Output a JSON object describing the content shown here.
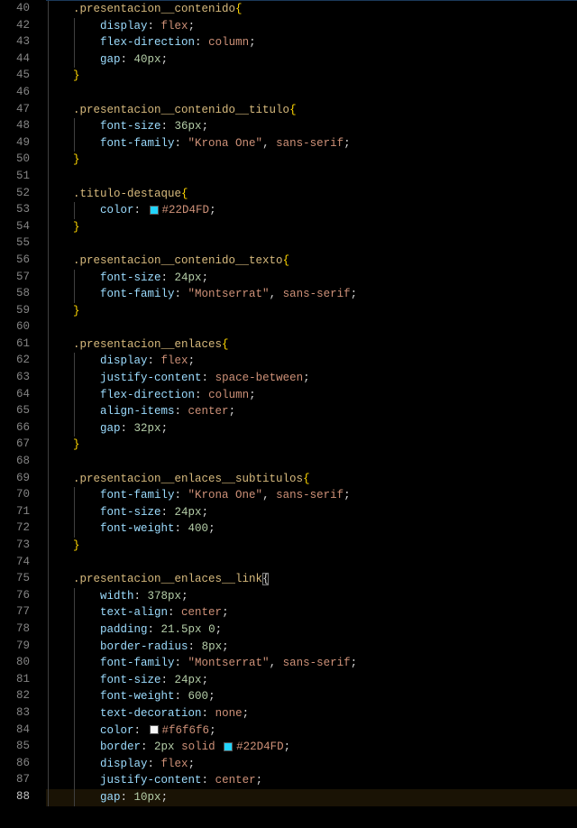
{
  "editor": {
    "language": "css",
    "active_line": 88
  },
  "lines": [
    {
      "n": 40,
      "ind": 1,
      "t": [
        {
          "c": "sel",
          "s": ".presentacion__contenido"
        },
        {
          "c": "brace",
          "s": "{"
        }
      ]
    },
    {
      "n": 42,
      "ind": 2,
      "t": [
        {
          "c": "prop",
          "s": "display"
        },
        {
          "c": "punc",
          "s": ": "
        },
        {
          "c": "val",
          "s": "flex"
        },
        {
          "c": "punc",
          "s": ";"
        }
      ]
    },
    {
      "n": 43,
      "ind": 2,
      "t": [
        {
          "c": "prop",
          "s": "flex-direction"
        },
        {
          "c": "punc",
          "s": ": "
        },
        {
          "c": "val",
          "s": "column"
        },
        {
          "c": "punc",
          "s": ";"
        }
      ]
    },
    {
      "n": 44,
      "ind": 2,
      "t": [
        {
          "c": "prop",
          "s": "gap"
        },
        {
          "c": "punc",
          "s": ": "
        },
        {
          "c": "num",
          "s": "40px"
        },
        {
          "c": "punc",
          "s": ";"
        }
      ]
    },
    {
      "n": 45,
      "ind": 1,
      "t": [
        {
          "c": "brace",
          "s": "}"
        }
      ]
    },
    {
      "n": 46,
      "ind": 1,
      "t": []
    },
    {
      "n": 47,
      "ind": 1,
      "t": [
        {
          "c": "sel",
          "s": ".presentacion__contenido__titulo"
        },
        {
          "c": "brace",
          "s": "{"
        }
      ]
    },
    {
      "n": 48,
      "ind": 2,
      "t": [
        {
          "c": "prop",
          "s": "font-size"
        },
        {
          "c": "punc",
          "s": ": "
        },
        {
          "c": "num",
          "s": "36px"
        },
        {
          "c": "punc",
          "s": ";"
        }
      ]
    },
    {
      "n": 49,
      "ind": 2,
      "t": [
        {
          "c": "prop",
          "s": "font-family"
        },
        {
          "c": "punc",
          "s": ": "
        },
        {
          "c": "str",
          "s": "\"Krona One\""
        },
        {
          "c": "punc",
          "s": ", "
        },
        {
          "c": "val",
          "s": "sans-serif"
        },
        {
          "c": "punc",
          "s": ";"
        }
      ]
    },
    {
      "n": 50,
      "ind": 1,
      "t": [
        {
          "c": "brace",
          "s": "}"
        }
      ]
    },
    {
      "n": 51,
      "ind": 1,
      "t": []
    },
    {
      "n": 52,
      "ind": 1,
      "t": [
        {
          "c": "sel",
          "s": ".titulo-destaque"
        },
        {
          "c": "brace",
          "s": "{"
        }
      ]
    },
    {
      "n": 53,
      "ind": 2,
      "t": [
        {
          "c": "prop",
          "s": "color"
        },
        {
          "c": "punc",
          "s": ": "
        },
        {
          "c": "swatch",
          "sw": "#22D4FD"
        },
        {
          "c": "val",
          "s": "#22D4FD"
        },
        {
          "c": "punc",
          "s": ";"
        }
      ]
    },
    {
      "n": 54,
      "ind": 1,
      "t": [
        {
          "c": "brace",
          "s": "}"
        }
      ]
    },
    {
      "n": 55,
      "ind": 1,
      "t": []
    },
    {
      "n": 56,
      "ind": 1,
      "t": [
        {
          "c": "sel",
          "s": ".presentacion__contenido__texto"
        },
        {
          "c": "brace",
          "s": "{"
        }
      ]
    },
    {
      "n": 57,
      "ind": 2,
      "t": [
        {
          "c": "prop",
          "s": "font-size"
        },
        {
          "c": "punc",
          "s": ": "
        },
        {
          "c": "num",
          "s": "24px"
        },
        {
          "c": "punc",
          "s": ";"
        }
      ]
    },
    {
      "n": 58,
      "ind": 2,
      "t": [
        {
          "c": "prop",
          "s": "font-family"
        },
        {
          "c": "punc",
          "s": ": "
        },
        {
          "c": "str",
          "s": "\"Montserrat\""
        },
        {
          "c": "punc",
          "s": ", "
        },
        {
          "c": "val",
          "s": "sans-serif"
        },
        {
          "c": "punc",
          "s": ";"
        }
      ]
    },
    {
      "n": 59,
      "ind": 1,
      "t": [
        {
          "c": "brace",
          "s": "}"
        }
      ]
    },
    {
      "n": 60,
      "ind": 1,
      "t": []
    },
    {
      "n": 61,
      "ind": 1,
      "t": [
        {
          "c": "sel",
          "s": ".presentacion__enlaces"
        },
        {
          "c": "brace",
          "s": "{"
        }
      ]
    },
    {
      "n": 62,
      "ind": 2,
      "t": [
        {
          "c": "prop",
          "s": "display"
        },
        {
          "c": "punc",
          "s": ": "
        },
        {
          "c": "val",
          "s": "flex"
        },
        {
          "c": "punc",
          "s": ";"
        }
      ]
    },
    {
      "n": 63,
      "ind": 2,
      "t": [
        {
          "c": "prop",
          "s": "justify-content"
        },
        {
          "c": "punc",
          "s": ": "
        },
        {
          "c": "val",
          "s": "space-between"
        },
        {
          "c": "punc",
          "s": ";"
        }
      ]
    },
    {
      "n": 64,
      "ind": 2,
      "t": [
        {
          "c": "prop",
          "s": "flex-direction"
        },
        {
          "c": "punc",
          "s": ": "
        },
        {
          "c": "val",
          "s": "column"
        },
        {
          "c": "punc",
          "s": ";"
        }
      ]
    },
    {
      "n": 65,
      "ind": 2,
      "t": [
        {
          "c": "prop",
          "s": "align-items"
        },
        {
          "c": "punc",
          "s": ": "
        },
        {
          "c": "val",
          "s": "center"
        },
        {
          "c": "punc",
          "s": ";"
        }
      ]
    },
    {
      "n": 66,
      "ind": 2,
      "t": [
        {
          "c": "prop",
          "s": "gap"
        },
        {
          "c": "punc",
          "s": ": "
        },
        {
          "c": "num",
          "s": "32px"
        },
        {
          "c": "punc",
          "s": ";"
        }
      ]
    },
    {
      "n": 67,
      "ind": 1,
      "t": [
        {
          "c": "brace",
          "s": "}"
        }
      ]
    },
    {
      "n": 68,
      "ind": 1,
      "t": []
    },
    {
      "n": 69,
      "ind": 1,
      "t": [
        {
          "c": "sel",
          "s": ".presentacion__enlaces__subtitulos"
        },
        {
          "c": "brace",
          "s": "{"
        }
      ]
    },
    {
      "n": 70,
      "ind": 2,
      "t": [
        {
          "c": "prop",
          "s": "font-family"
        },
        {
          "c": "punc",
          "s": ": "
        },
        {
          "c": "str",
          "s": "\"Krona One\""
        },
        {
          "c": "punc",
          "s": ", "
        },
        {
          "c": "val",
          "s": "sans-serif"
        },
        {
          "c": "punc",
          "s": ";"
        }
      ]
    },
    {
      "n": 71,
      "ind": 2,
      "t": [
        {
          "c": "prop",
          "s": "font-size"
        },
        {
          "c": "punc",
          "s": ": "
        },
        {
          "c": "num",
          "s": "24px"
        },
        {
          "c": "punc",
          "s": ";"
        }
      ]
    },
    {
      "n": 72,
      "ind": 2,
      "t": [
        {
          "c": "prop",
          "s": "font-weight"
        },
        {
          "c": "punc",
          "s": ": "
        },
        {
          "c": "num",
          "s": "400"
        },
        {
          "c": "punc",
          "s": ";"
        }
      ]
    },
    {
      "n": 73,
      "ind": 1,
      "t": [
        {
          "c": "brace",
          "s": "}"
        }
      ]
    },
    {
      "n": 74,
      "ind": 1,
      "t": []
    },
    {
      "n": 75,
      "ind": 1,
      "t": [
        {
          "c": "sel",
          "s": ".presentacion__enlaces__link"
        },
        {
          "c": "brace-muted",
          "s": "{"
        },
        {
          "c": "cursor"
        }
      ]
    },
    {
      "n": 76,
      "ind": 2,
      "t": [
        {
          "c": "prop",
          "s": "width"
        },
        {
          "c": "punc",
          "s": ": "
        },
        {
          "c": "num",
          "s": "378px"
        },
        {
          "c": "punc",
          "s": ";"
        }
      ]
    },
    {
      "n": 77,
      "ind": 2,
      "t": [
        {
          "c": "prop",
          "s": "text-align"
        },
        {
          "c": "punc",
          "s": ": "
        },
        {
          "c": "val",
          "s": "center"
        },
        {
          "c": "punc",
          "s": ";"
        }
      ]
    },
    {
      "n": 78,
      "ind": 2,
      "t": [
        {
          "c": "prop",
          "s": "padding"
        },
        {
          "c": "punc",
          "s": ": "
        },
        {
          "c": "num",
          "s": "21.5px"
        },
        {
          "c": "punc",
          "s": " "
        },
        {
          "c": "num",
          "s": "0"
        },
        {
          "c": "punc",
          "s": ";"
        }
      ]
    },
    {
      "n": 79,
      "ind": 2,
      "t": [
        {
          "c": "prop",
          "s": "border-radius"
        },
        {
          "c": "punc",
          "s": ": "
        },
        {
          "c": "num",
          "s": "8px"
        },
        {
          "c": "punc",
          "s": ";"
        }
      ]
    },
    {
      "n": 80,
      "ind": 2,
      "t": [
        {
          "c": "prop",
          "s": "font-family"
        },
        {
          "c": "punc",
          "s": ": "
        },
        {
          "c": "str",
          "s": "\"Montserrat\""
        },
        {
          "c": "punc",
          "s": ", "
        },
        {
          "c": "val",
          "s": "sans-serif"
        },
        {
          "c": "punc",
          "s": ";"
        }
      ]
    },
    {
      "n": 81,
      "ind": 2,
      "t": [
        {
          "c": "prop",
          "s": "font-size"
        },
        {
          "c": "punc",
          "s": ": "
        },
        {
          "c": "num",
          "s": "24px"
        },
        {
          "c": "punc",
          "s": ";"
        }
      ]
    },
    {
      "n": 82,
      "ind": 2,
      "t": [
        {
          "c": "prop",
          "s": "font-weight"
        },
        {
          "c": "punc",
          "s": ": "
        },
        {
          "c": "num",
          "s": "600"
        },
        {
          "c": "punc",
          "s": ";"
        }
      ]
    },
    {
      "n": 83,
      "ind": 2,
      "t": [
        {
          "c": "prop",
          "s": "text-decoration"
        },
        {
          "c": "punc",
          "s": ": "
        },
        {
          "c": "val",
          "s": "none"
        },
        {
          "c": "punc",
          "s": ";"
        }
      ]
    },
    {
      "n": 84,
      "ind": 2,
      "t": [
        {
          "c": "prop",
          "s": "color"
        },
        {
          "c": "punc",
          "s": ": "
        },
        {
          "c": "swatch",
          "sw": "#f6f6f6"
        },
        {
          "c": "val",
          "s": "#f6f6f6"
        },
        {
          "c": "punc",
          "s": ";"
        }
      ]
    },
    {
      "n": 85,
      "ind": 2,
      "t": [
        {
          "c": "prop",
          "s": "border"
        },
        {
          "c": "punc",
          "s": ": "
        },
        {
          "c": "num",
          "s": "2px"
        },
        {
          "c": "punc",
          "s": " "
        },
        {
          "c": "val",
          "s": "solid"
        },
        {
          "c": "punc",
          "s": " "
        },
        {
          "c": "swatch",
          "sw": "#22D4FD"
        },
        {
          "c": "val",
          "s": "#22D4FD"
        },
        {
          "c": "punc",
          "s": ";"
        }
      ]
    },
    {
      "n": 86,
      "ind": 2,
      "t": [
        {
          "c": "prop",
          "s": "display"
        },
        {
          "c": "punc",
          "s": ": "
        },
        {
          "c": "val",
          "s": "flex"
        },
        {
          "c": "punc",
          "s": ";"
        }
      ]
    },
    {
      "n": 87,
      "ind": 2,
      "t": [
        {
          "c": "prop",
          "s": "justify-content"
        },
        {
          "c": "punc",
          "s": ": "
        },
        {
          "c": "val",
          "s": "center"
        },
        {
          "c": "punc",
          "s": ";"
        }
      ]
    },
    {
      "n": 88,
      "ind": 2,
      "hl": true,
      "t": [
        {
          "c": "prop",
          "s": "gap"
        },
        {
          "c": "punc",
          "s": ": "
        },
        {
          "c": "num",
          "s": "10px"
        },
        {
          "c": "punc",
          "s": ";"
        }
      ]
    }
  ]
}
